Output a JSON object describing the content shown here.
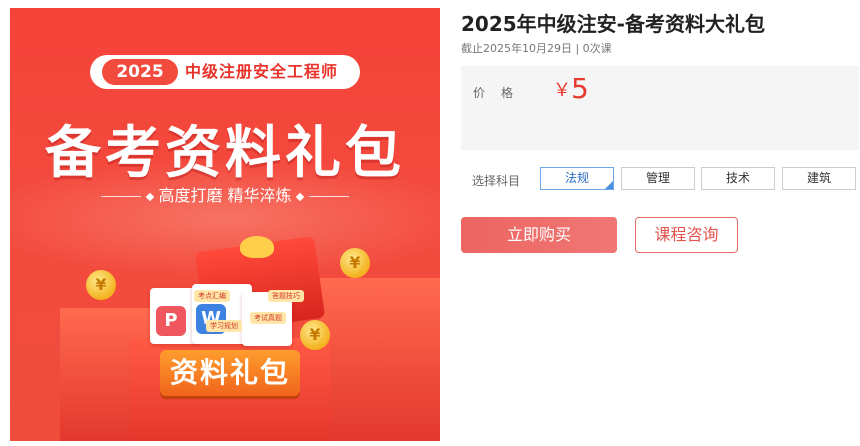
{
  "banner": {
    "year": "2025",
    "exam_name": "中级注册安全工程师",
    "headline": "备考资料礼包",
    "slogan_left": "高度打磨",
    "slogan_right": "精华淬炼",
    "package_label": "资料礼包",
    "tags": [
      "考点汇编",
      "答题技巧",
      "学习规划",
      "考试真题"
    ],
    "icon_pdf": "P",
    "icon_word": "W",
    "coin_symbol": "¥"
  },
  "product": {
    "title": "2025年中级注安-备考资料大礼包",
    "meta": "截止2025年10月29日 | 0次课",
    "price_label": "价格",
    "currency": "￥",
    "price": "5",
    "subject_label": "选择科目",
    "subjects": [
      "法规",
      "管理",
      "技术",
      "建筑"
    ],
    "selected_subject": "法规",
    "buy_label": "立即购买",
    "consult_label": "课程咨询"
  },
  "colors": {
    "banner_red": "#f6433a",
    "price_red": "#e63a2e",
    "buy_button": "#ec6561",
    "selected_border": "#6aa6e8"
  }
}
